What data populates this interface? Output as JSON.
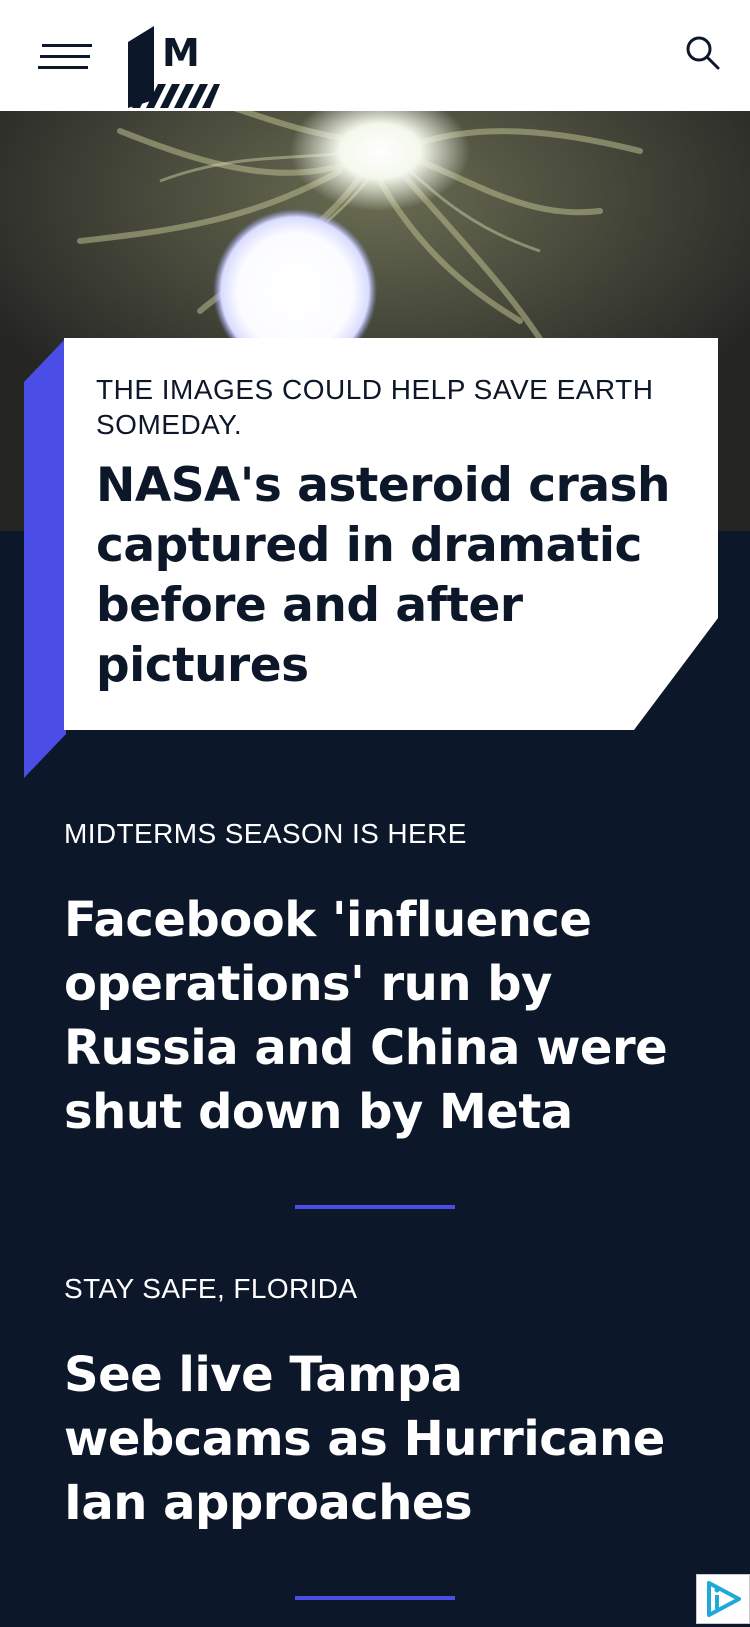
{
  "header": {
    "menu_icon": "hamburger-menu-icon",
    "logo_letter": "M",
    "search_icon": "search-icon"
  },
  "colors": {
    "navy": "#0d172a",
    "accent": "#4a4de6",
    "white": "#ffffff"
  },
  "featured": {
    "kicker": "THE IMAGES COULD HELP SAVE EARTH SOMEDAY.",
    "title": "NASA's asteroid crash captured in dramatic before and after pictures"
  },
  "stories": [
    {
      "kicker": "MIDTERMS SEASON IS HERE",
      "title": "Facebook 'influence operations' run by Russia and China were shut down by Meta"
    },
    {
      "kicker": "STAY SAFE, FLORIDA",
      "title": "See live Tampa webcams as Hurricane Ian approaches"
    }
  ],
  "ad": {
    "icon": "ad-choices-icon"
  }
}
